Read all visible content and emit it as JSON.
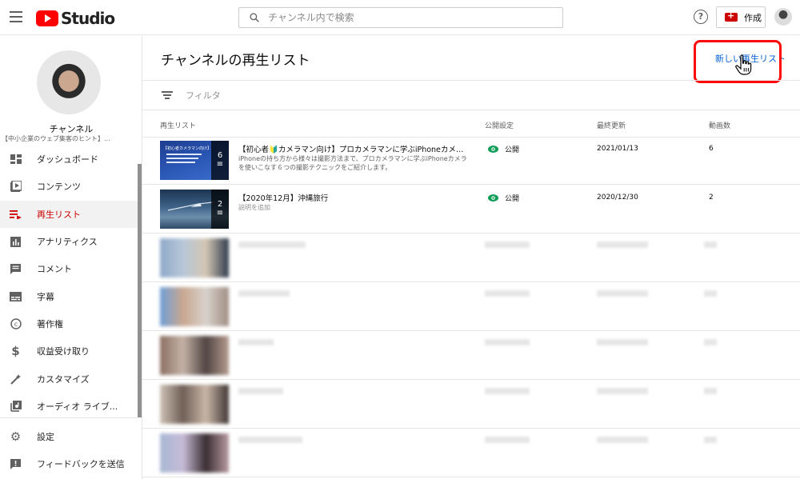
{
  "topbar": {
    "logo_text": "Studio",
    "search_placeholder": "チャンネル内で検索",
    "help_label": "?",
    "create_label": "作成"
  },
  "sidebar": {
    "channel_title": "チャンネル",
    "channel_subtitle": "【中小企業のウェブ集客のヒント】...",
    "items": [
      {
        "label": "ダッシュボード",
        "icon": "dashboard-icon"
      },
      {
        "label": "コンテンツ",
        "icon": "content-icon"
      },
      {
        "label": "再生リスト",
        "icon": "playlist-icon",
        "active": true
      },
      {
        "label": "アナリティクス",
        "icon": "analytics-icon"
      },
      {
        "label": "コメント",
        "icon": "comment-icon"
      },
      {
        "label": "字幕",
        "icon": "subtitles-icon"
      },
      {
        "label": "著作権",
        "icon": "copyright-icon"
      },
      {
        "label": "収益受け取り",
        "icon": "dollar-icon"
      },
      {
        "label": "カスタマイズ",
        "icon": "customize-icon"
      },
      {
        "label": "オーディオ ライブ...",
        "icon": "audio-library-icon"
      }
    ],
    "bottom_items": [
      {
        "label": "設定",
        "icon": "gear-icon"
      },
      {
        "label": "フィードバックを送信",
        "icon": "feedback-icon"
      }
    ]
  },
  "main": {
    "page_title": "チャンネルの再生リスト",
    "new_playlist_label": "新しい再生リスト",
    "filter_label": "フィルタ",
    "columns": {
      "playlist": "再生リスト",
      "visibility": "公開設定",
      "last_updated": "最終更新",
      "video_count": "動画数"
    },
    "rows": [
      {
        "title": "【初心者🔰カメラマン向け】プロカメラマンに学ぶiPhoneカメラを...",
        "description": "iPhoneの持ち方から様々は撮影方法まで、プロカメラマンに学ぶiPhoneカメラを使いこなす６つの撮影テクニックをご紹介します。",
        "visibility": "公開",
        "last_updated": "2021/01/13",
        "video_count": "6",
        "thumb_count": "6",
        "thumb_caption": "【初心者カメラマン向け】"
      },
      {
        "title": "【2020年12月】沖縄旅行",
        "description": "説明を追加",
        "visibility": "公開",
        "last_updated": "2020/12/30",
        "video_count": "2",
        "thumb_count": "2"
      }
    ]
  },
  "colors": {
    "brand_red": "#ff0000",
    "active_red": "#cc0000",
    "link_blue": "#065fd4",
    "public_green": "#0f9d58",
    "highlight_red": "#ff0a0a"
  }
}
